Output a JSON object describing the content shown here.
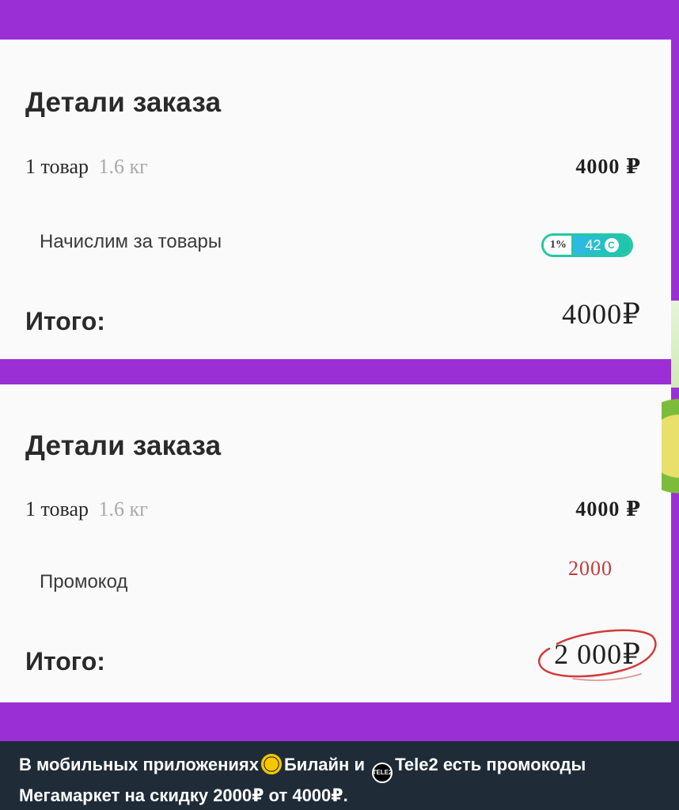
{
  "card1": {
    "title": "Детали заказа",
    "items_count": "1 товар",
    "items_weight": "1.6 кг",
    "items_price": "4000 ₽",
    "bonus_label": "Начислим за товары",
    "bonus_percent": "1%",
    "bonus_amount": "42",
    "total_label": "Итого:",
    "total_value": "4000₽"
  },
  "card2": {
    "title": "Детали заказа",
    "items_count": "1 товар",
    "items_weight": "1.6 кг",
    "items_price": "4000 ₽",
    "promo_label": "Промокод",
    "promo_value": "2000",
    "total_label": "Итого:",
    "total_value": "2 000₽"
  },
  "caption": {
    "part1": "В мобильных приложениях",
    "part2": "Билайн и ",
    "part3": "Tele2 есть промокоды Мегамаркет на скидку 2000₽ от 4000₽.",
    "tele2_icon_text": "TELE2"
  },
  "colors": {
    "background": "#9b2fd6",
    "card": "#fafafa",
    "promo": "#c23b3b",
    "bonus_accent": "#25c7a3",
    "caption_bg": "#1f2c38"
  }
}
